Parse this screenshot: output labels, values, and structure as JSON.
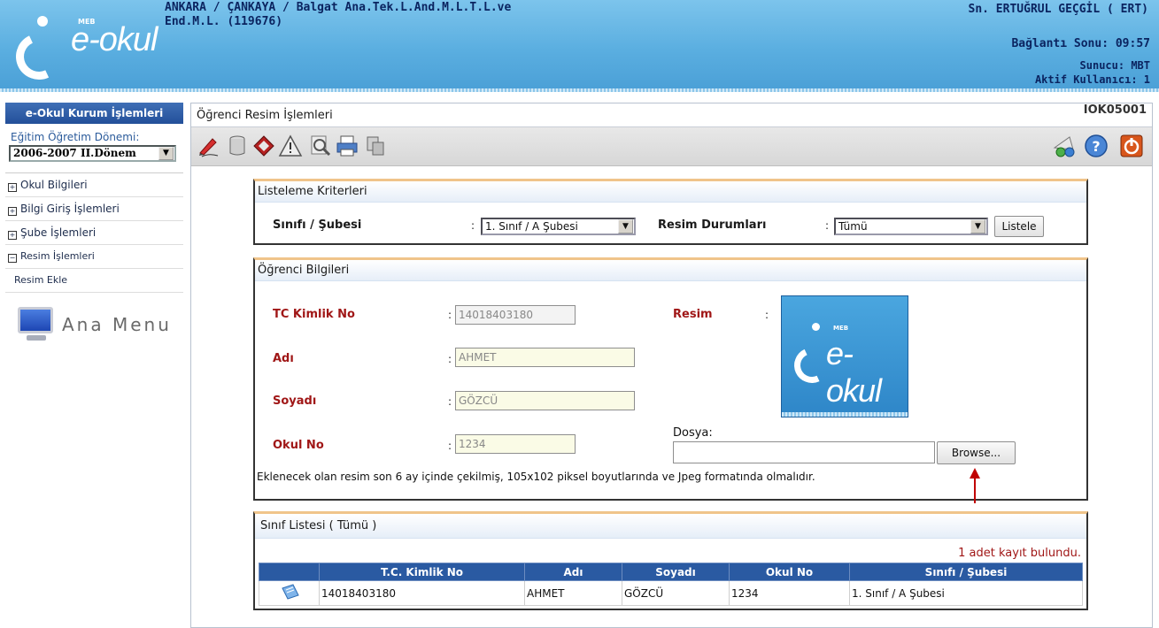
{
  "header": {
    "logo_brand": "e-okul",
    "logo_meb": "MEB",
    "school_line1": "ANKARA / ÇANKAYA / Balgat Ana.Tek.L.And.M.L.T.L.ve",
    "school_line2": "End.M.L. (119676)",
    "user": "Sn. ERTUĞRUL GEÇGİL ( ERT)",
    "connection": "Bağlantı Sonu: 09:57",
    "server": "Sunucu: MBT",
    "active_users": "Aktif Kullanıcı: 1"
  },
  "sidebar": {
    "title": "e-Okul Kurum İşlemleri",
    "period_label": "Eğitim Öğretim Dönemi:",
    "period_value": "2006-2007 II.Dönem",
    "items": [
      {
        "label": "Okul Bilgileri",
        "marker": "+"
      },
      {
        "label": "Bilgi Giriş İşlemleri",
        "marker": "+"
      },
      {
        "label": "Şube İşlemleri",
        "marker": "+"
      },
      {
        "label": "Resim İşlemleri",
        "marker": "−"
      },
      {
        "label": "Resim Ekle",
        "marker": ""
      }
    ],
    "ana_menu": "Ana Menu"
  },
  "page": {
    "title": "Öğrenci Resim İşlemleri",
    "code": "IOK05001"
  },
  "toolbar": {
    "icons": [
      "edit-icon",
      "database-icon",
      "diamond-icon",
      "warning-icon",
      "search-icon",
      "print-icon",
      "export-icon",
      "mail-icon",
      "help-icon",
      "power-icon"
    ]
  },
  "criteria": {
    "title": "Listeleme Kriterleri",
    "class_label": "Sınıfı / Şubesi",
    "class_value": "1. Sınıf / A Şubesi",
    "status_label": "Resim Durumları",
    "status_value": "Tümü",
    "list_button": "Listele"
  },
  "student": {
    "title": "Öğrenci Bilgileri",
    "tc_label": "TC Kimlik No",
    "tc_value": "14018403180",
    "name_label": "Adı",
    "name_value": "AHMET",
    "surname_label": "Soyadı",
    "surname_value": "GÖZCÜ",
    "schoolno_label": "Okul No",
    "schoolno_value": "1234",
    "photo_label": "Resim",
    "file_label": "Dosya:",
    "browse_button": "Browse...",
    "note": "Eklenecek olan resim son 6 ay içinde çekilmiş, 105x102 piksel boyutlarında ve Jpeg formatında olmalıdır."
  },
  "class_list": {
    "title": "Sınıf Listesi ( Tümü )",
    "count": "1 adet kayıt bulundu.",
    "columns": [
      "",
      "T.C. Kimlik No",
      "Adı",
      "Soyadı",
      "Okul No",
      "Sınıfı / Şubesi"
    ],
    "rows": [
      [
        "",
        "14018403180",
        "AHMET",
        "GÖZCÜ",
        "1234",
        "1. Sınıf / A Şubesi"
      ]
    ]
  },
  "colors": {
    "header_blue": "#5aaee0",
    "nav_dark_blue": "#234f99",
    "label_red": "#a01717",
    "panel_border_orange": "#f0c48a"
  }
}
